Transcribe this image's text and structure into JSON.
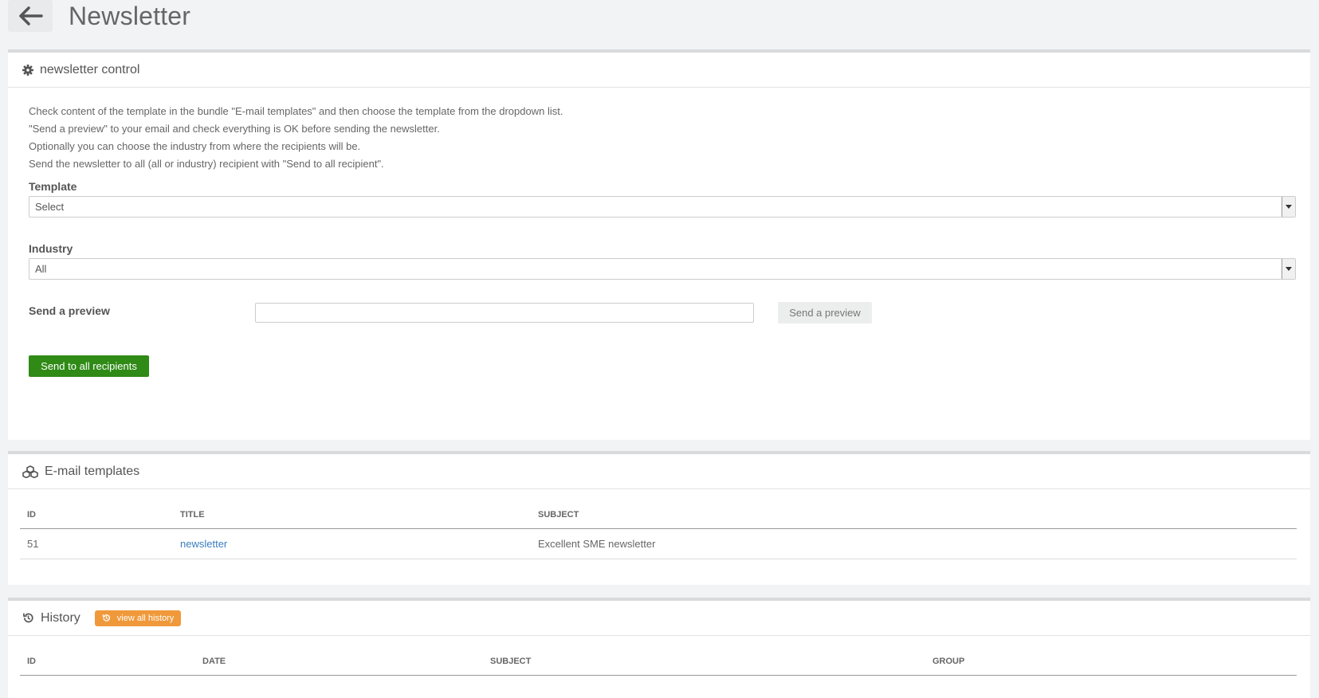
{
  "header": {
    "title": "Newsletter",
    "back_icon": "arrow-left-icon"
  },
  "control": {
    "title": "newsletter control",
    "help": [
      "Check content of the template in the bundle \"E-mail templates\" and then choose the template from the dropdown list.",
      "\"Send a preview\" to your email and check everything is OK before sending the newsletter.",
      "Optionally you can choose the industry from where the recipients will be.",
      "Send the newsletter to all (all or industry) recipient with \"Send to all recipient\"."
    ],
    "template_label": "Template",
    "template_value": "Select",
    "industry_label": "Industry",
    "industry_value": "All",
    "preview_label": "Send a preview",
    "preview_value": "",
    "preview_button": "Send a preview",
    "send_all_button": "Send to all recipients"
  },
  "templates": {
    "title": "E-mail templates",
    "columns": [
      "ID",
      "TITLE",
      "SUBJECT"
    ],
    "rows": [
      {
        "id": "51",
        "title": "newsletter",
        "subject": "Excellent SME newsletter"
      }
    ]
  },
  "history": {
    "title": "History",
    "view_all": "view all history",
    "columns": [
      "ID",
      "DATE",
      "SUBJECT",
      "GROUP"
    ]
  },
  "colors": {
    "green": "#2f8a16",
    "orange": "#f0993a",
    "link": "#3b7dc0"
  }
}
